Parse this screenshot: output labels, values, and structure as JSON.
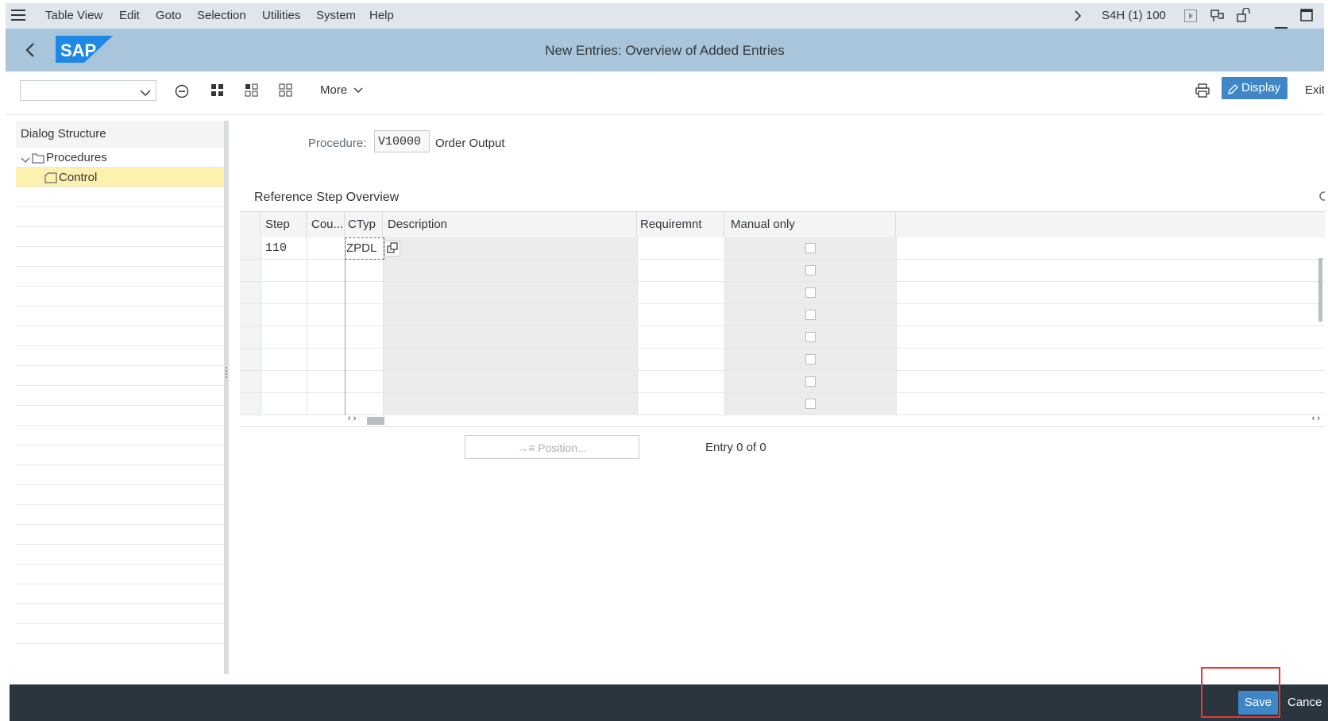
{
  "menu": {
    "items": [
      "Table View",
      "Edit",
      "Goto",
      "Selection",
      "Utilities",
      "System",
      "Help"
    ],
    "system_id": "S4H (1) 100"
  },
  "title": "New Entries: Overview of Added Entries",
  "logo_text": "SAP",
  "toolbar": {
    "more_label": "More",
    "display_label": "Display",
    "exit_label": "Exit"
  },
  "dialog": {
    "header": "Dialog Structure",
    "items": [
      {
        "label": "Procedures",
        "selected": false
      },
      {
        "label": "Control",
        "selected": true
      }
    ]
  },
  "procedure": {
    "label": "Procedure:",
    "value": "V10000",
    "description": "Order Output"
  },
  "table": {
    "title": "Reference Step Overview",
    "columns": [
      "Step",
      "Cou...",
      "CTyp",
      "Description",
      "Requiremnt",
      "Manual only"
    ],
    "rows": [
      {
        "step": "110",
        "counter": "",
        "ctype": "ZPDL",
        "description": "",
        "requirement": "",
        "manual_only": false
      },
      {
        "step": "",
        "counter": "",
        "ctype": "",
        "description": "",
        "requirement": "",
        "manual_only": false
      },
      {
        "step": "",
        "counter": "",
        "ctype": "",
        "description": "",
        "requirement": "",
        "manual_only": false
      },
      {
        "step": "",
        "counter": "",
        "ctype": "",
        "description": "",
        "requirement": "",
        "manual_only": false
      },
      {
        "step": "",
        "counter": "",
        "ctype": "",
        "description": "",
        "requirement": "",
        "manual_only": false
      },
      {
        "step": "",
        "counter": "",
        "ctype": "",
        "description": "",
        "requirement": "",
        "manual_only": false
      },
      {
        "step": "",
        "counter": "",
        "ctype": "",
        "description": "",
        "requirement": "",
        "manual_only": false
      },
      {
        "step": "",
        "counter": "",
        "ctype": "",
        "description": "",
        "requirement": "",
        "manual_only": false
      }
    ]
  },
  "position_label": "Position...",
  "entry_text": "Entry 0 of 0",
  "footer": {
    "save_label": "Save",
    "cancel_label": "Cance"
  },
  "colors": {
    "menubar": "#dfe6ec",
    "titlebar": "#a9c5dc",
    "accent": "#3f86c7",
    "footer": "#2b3540",
    "highlight": "#e53935",
    "selected_row": "#fdf1b0"
  },
  "icons": [
    "hamburger-menu-icon",
    "back-icon",
    "chevron-down-icon",
    "minus-circle-icon",
    "select-all-icon",
    "select-block-icon",
    "deselect-icon",
    "print-icon",
    "edit-icon",
    "folder-icon",
    "control-icon",
    "copy-icon",
    "chevron-right-icon",
    "play-icon",
    "layout-icon",
    "lock-icon",
    "minimize-icon",
    "maximize-icon"
  ]
}
